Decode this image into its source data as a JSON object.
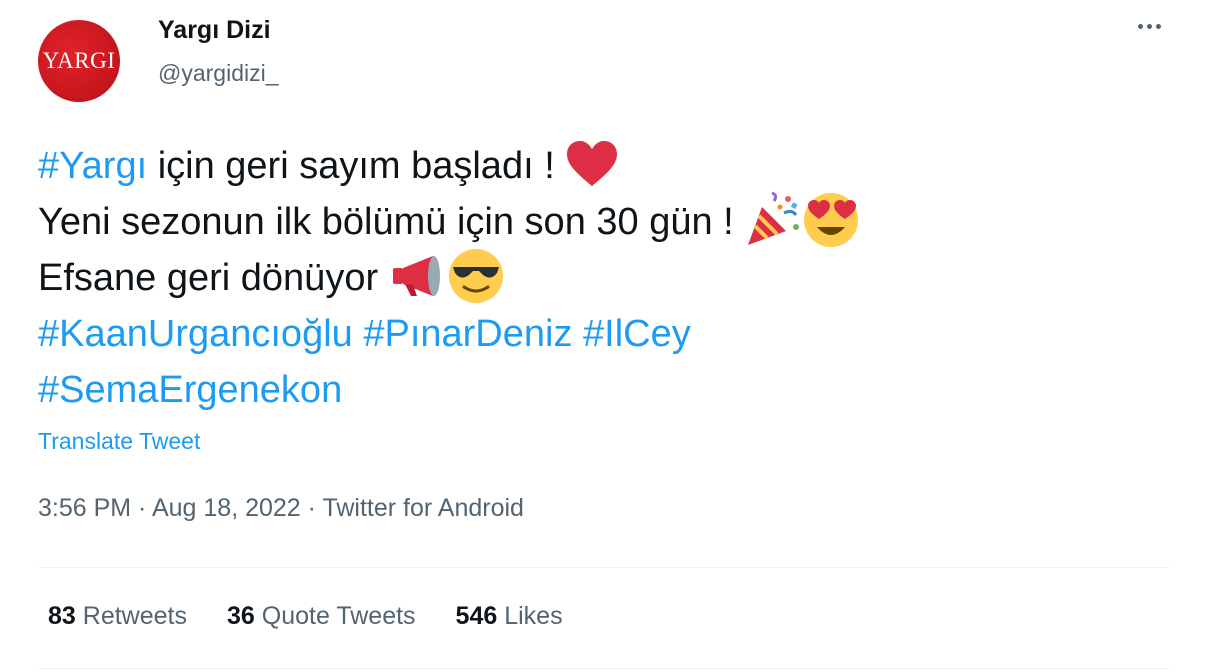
{
  "author": {
    "avatar_text": "YARGI",
    "display_name": "Yargı Dizi",
    "handle": "@yargidizi_"
  },
  "tweet": {
    "line1": {
      "hashtag": "#Yargı",
      "text": " için geri sayım başladı ! "
    },
    "line2": {
      "text": "Yeni sezonun ilk bölümü için son 30 gün ! "
    },
    "line3": {
      "text": "Efsane geri dönüyor "
    },
    "hashtags_line4": [
      "#KaanUrgancıoğlu",
      "#PınarDeniz",
      "#IlCey"
    ],
    "hashtags_line5": [
      "#SemaErgenekon"
    ],
    "emojis": {
      "line1": [
        "red-heart-icon"
      ],
      "line2": [
        "party-popper-icon",
        "heart-eyes-face-icon"
      ],
      "line3": [
        "megaphone-icon",
        "sunglasses-face-icon"
      ]
    }
  },
  "translate_label": "Translate Tweet",
  "meta": {
    "time": "3:56 PM",
    "separator": " · ",
    "date": "Aug 18, 2022",
    "source": "Twitter for Android"
  },
  "stats": {
    "retweets": {
      "count": "83",
      "label": "Retweets"
    },
    "quotes": {
      "count": "36",
      "label": "Quote Tweets"
    },
    "likes": {
      "count": "546",
      "label": "Likes"
    }
  },
  "colors": {
    "link": "#1d9bf0",
    "text": "#0f1419",
    "secondary": "#536471",
    "avatar_red": "#c4161c"
  }
}
